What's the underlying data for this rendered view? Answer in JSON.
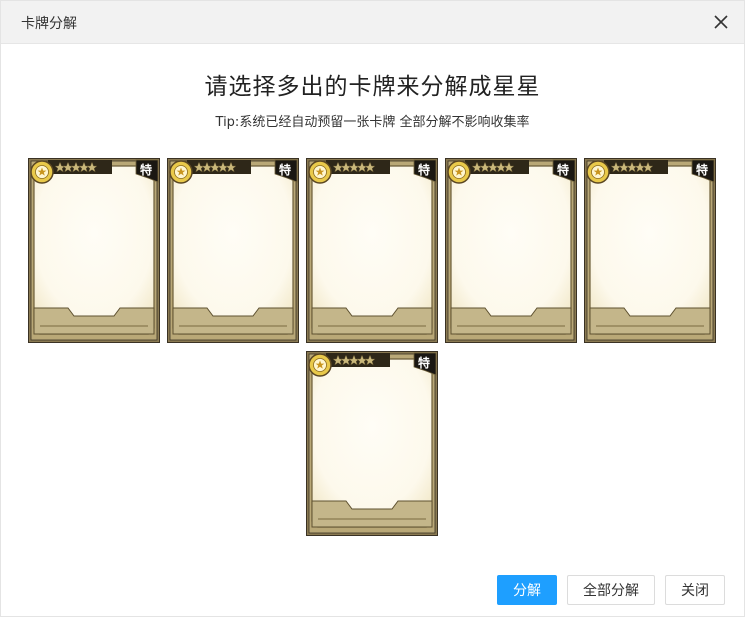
{
  "dialog": {
    "title": "卡牌分解",
    "heading": "请选择多出的卡牌来分解成星星",
    "tip": "Tip:系统已经自动预留一张卡牌 全部分解不影响收集率"
  },
  "cards": [
    {
      "badge": "特",
      "stars": 5
    },
    {
      "badge": "特",
      "stars": 5
    },
    {
      "badge": "特",
      "stars": 5
    },
    {
      "badge": "特",
      "stars": 5
    },
    {
      "badge": "特",
      "stars": 5
    },
    {
      "badge": "特",
      "stars": 5
    }
  ],
  "buttons": {
    "decompose": "分解",
    "decompose_all": "全部分解",
    "close": "关闭"
  },
  "colors": {
    "primary": "#1e9fff",
    "frame_gold": "#8a7a52",
    "frame_dark": "#3a3224",
    "card_fill": "#fdf9ec"
  }
}
